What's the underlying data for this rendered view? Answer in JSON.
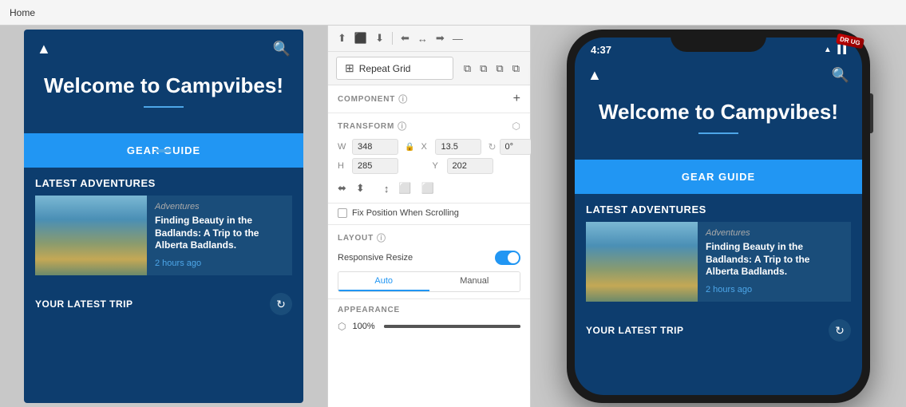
{
  "topbar": {
    "breadcrumb": "Home"
  },
  "toolbar": {
    "align_icons": [
      "⬆",
      "⬆⬇",
      "⬇",
      "|",
      "⬅",
      "↕",
      "➡",
      "—"
    ],
    "repeat_grid_label": "Repeat Grid",
    "copy_icons": [
      "⧉",
      "⧉",
      "⧉",
      "⧉"
    ]
  },
  "component_section": {
    "label": "COMPONENT",
    "add_label": "+"
  },
  "transform_section": {
    "label": "TRANSFORM",
    "w_label": "W",
    "h_label": "H",
    "x_label": "X",
    "y_label": "Y",
    "w_value": "348",
    "h_value": "285",
    "x_value": "13.5",
    "y_value": "202",
    "rotation_value": "0°"
  },
  "fix_position": {
    "label": "Fix Position When Scrolling"
  },
  "layout_section": {
    "label": "LAYOUT",
    "responsive_label": "Responsive Resize",
    "auto_label": "Auto",
    "manual_label": "Manual"
  },
  "appearance_section": {
    "label": "APPEARANCE",
    "opacity_value": "100%"
  },
  "left_preview": {
    "hero_title": "Welcome to Campvibes!",
    "cta_label": "GEAR GUIDE",
    "section_label": "LATEST ADVENTURES",
    "adventure_category": "Adventures",
    "adventure_headline": "Finding Beauty in the Badlands: A Trip to the Alberta Badlands.",
    "adventure_time": "2 hours ago",
    "your_trip_label": "YOUR LATEST TRIP"
  },
  "right_preview": {
    "status_time": "4:37",
    "hero_title": "Welcome to Campvibes!",
    "cta_label": "GEAR GUIDE",
    "section_label": "LATEST ADVENTURES",
    "adventure_category": "Adventures",
    "adventure_headline": "Finding Beauty in the Badlands: A Trip to the Alberta Badlands.",
    "adventure_time": "2 hours ago",
    "your_trip_label": "YOUR LATEST TRIP",
    "badge": "DR\nUG"
  }
}
